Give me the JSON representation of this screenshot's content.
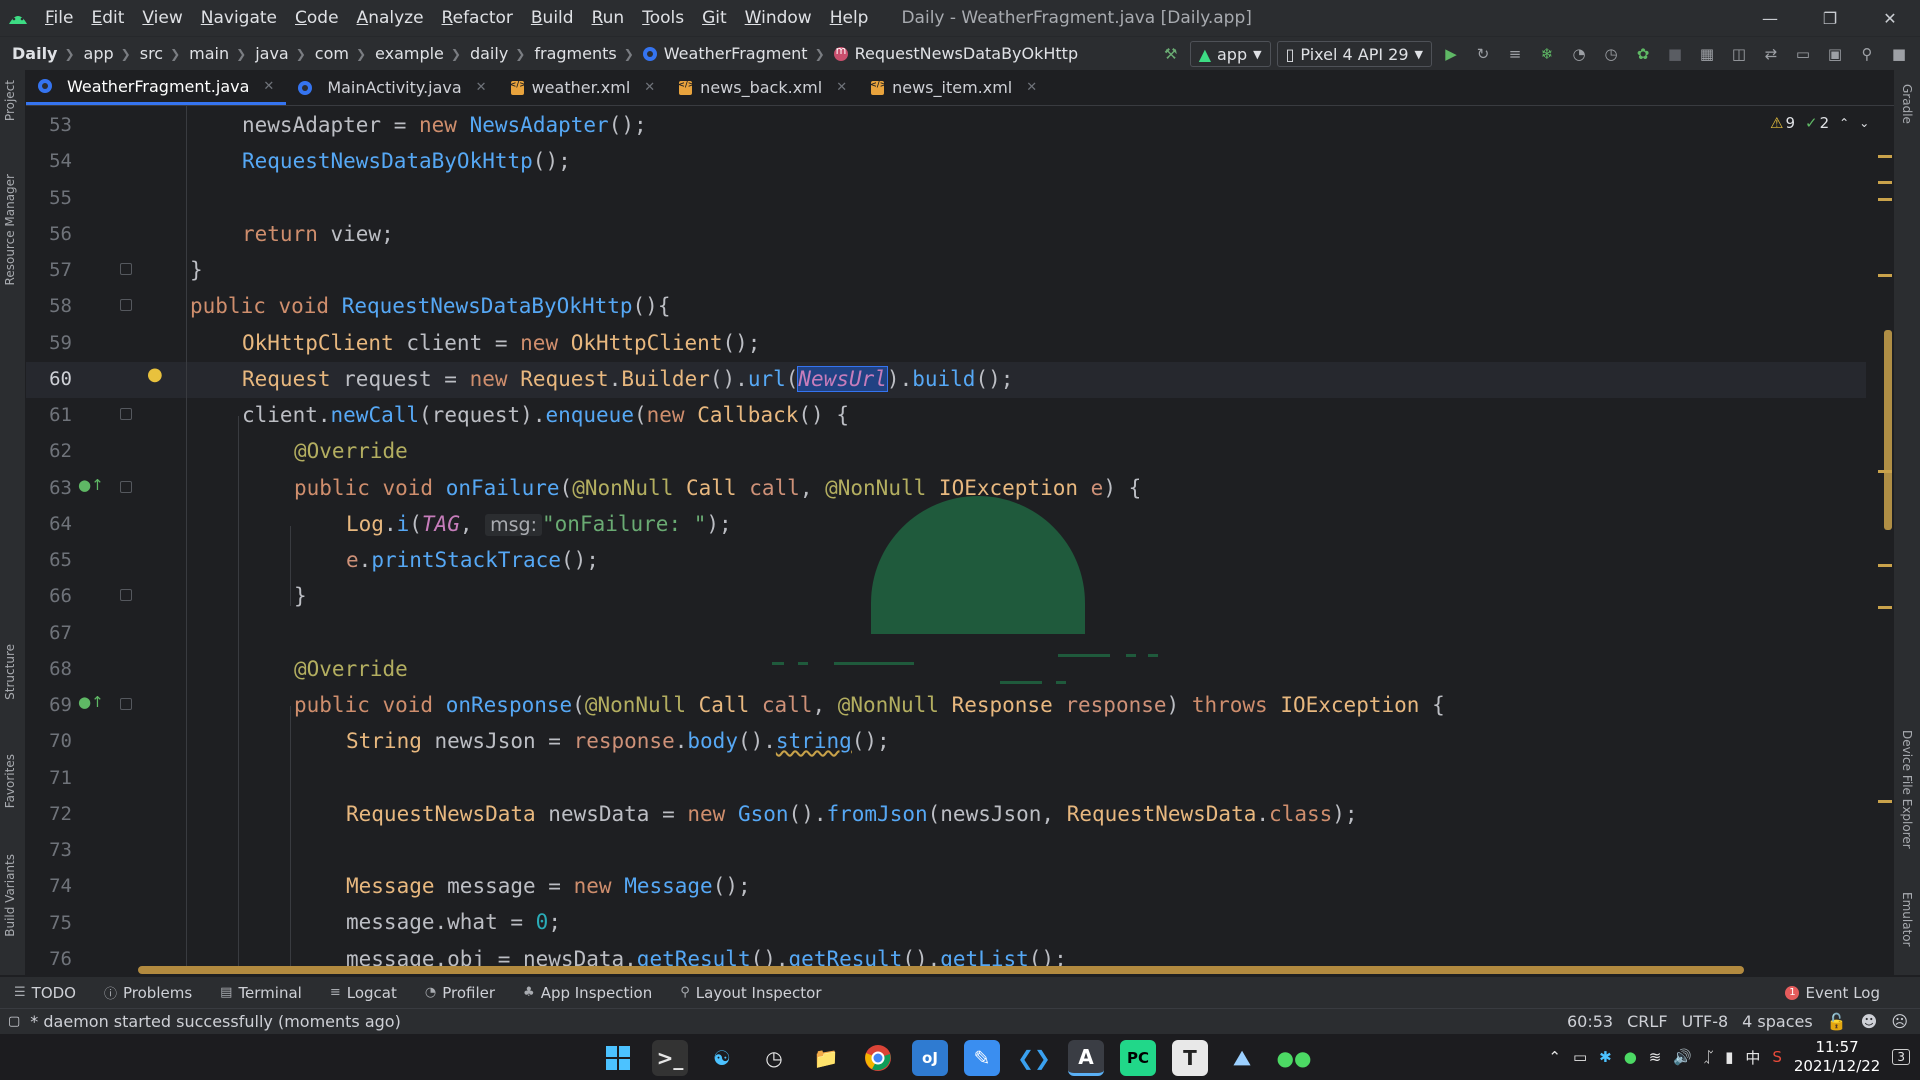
{
  "menubar": {
    "items": [
      "File",
      "Edit",
      "View",
      "Navigate",
      "Code",
      "Analyze",
      "Refactor",
      "Build",
      "Run",
      "Tools",
      "Git",
      "Window",
      "Help"
    ],
    "window_title": "Daily - WeatherFragment.java [Daily.app]"
  },
  "breadcrumb": [
    "Daily",
    "app",
    "src",
    "main",
    "java",
    "com",
    "example",
    "daily",
    "fragments",
    "WeatherFragment",
    "RequestNewsDataByOkHttp"
  ],
  "toolbar": {
    "run_config": "app",
    "device": "Pixel 4 API 29"
  },
  "tabs": [
    "WeatherFragment.java",
    "MainActivity.java",
    "weather.xml",
    "news_back.xml",
    "news_item.xml"
  ],
  "left_tool_windows": [
    "Project",
    "Resource Manager",
    "Structure",
    "Favorites",
    "Build Variants"
  ],
  "right_tool_windows": [
    "Gradle",
    "Device File Explorer",
    "Emulator"
  ],
  "inspections": {
    "warnings": "9",
    "weak_warnings": "2"
  },
  "editor": {
    "current_line": "60",
    "line_numbers": [
      "53",
      "54",
      "55",
      "56",
      "57",
      "58",
      "59",
      "60",
      "61",
      "62",
      "63",
      "64",
      "65",
      "66",
      "67",
      "68",
      "69",
      "70",
      "71",
      "72",
      "73",
      "74",
      "75",
      "76"
    ],
    "inlay_hint": "msg:"
  },
  "bottom_tools": [
    "TODO",
    "Problems",
    "Terminal",
    "Logcat",
    "Profiler",
    "App Inspection",
    "Layout Inspector"
  ],
  "event_log": {
    "label": "Event Log",
    "count": "1"
  },
  "status": {
    "message": "* daemon started successfully (moments ago)",
    "position": "60:53",
    "line_sep": "CRLF",
    "encoding": "UTF-8",
    "indent": "4 spaces"
  },
  "taskbar": {
    "time": "11:57",
    "date": "2021/12/22",
    "lang": "中",
    "notifications": "3"
  }
}
